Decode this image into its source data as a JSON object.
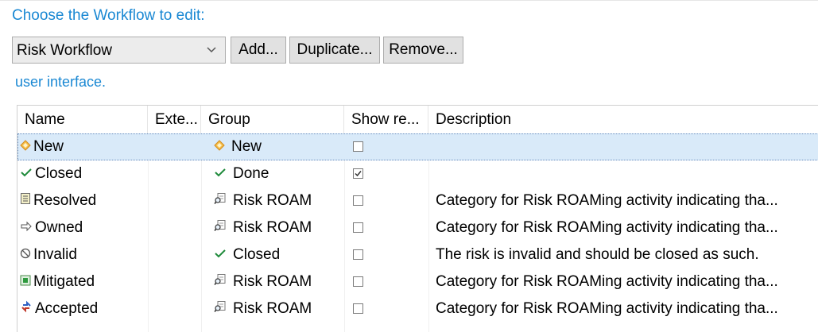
{
  "heading": "Choose the Workflow to edit:",
  "workflow_select": {
    "value": "Risk Workflow"
  },
  "buttons": {
    "add": "Add...",
    "duplicate": "Duplicate...",
    "remove": "Remove..."
  },
  "link": "user interface.",
  "table": {
    "columns": [
      "Name",
      "Exte...",
      "Group",
      "Show re...",
      "Description"
    ],
    "rows": [
      {
        "name": "New",
        "name_icon": "diamond-icon",
        "ext": "",
        "group": "New",
        "group_icon": "diamond-icon",
        "show": false,
        "description": ""
      },
      {
        "name": "Closed",
        "name_icon": "check-icon",
        "ext": "",
        "group": "Done",
        "group_icon": "check-icon",
        "show": true,
        "description": ""
      },
      {
        "name": "Resolved",
        "name_icon": "document-icon",
        "ext": "",
        "group": "Risk ROAM",
        "group_icon": "magnifier-icon",
        "show": false,
        "description": "Category for Risk ROAMing activity indicating tha..."
      },
      {
        "name": "Owned",
        "name_icon": "arrow-right-icon",
        "ext": "",
        "group": "Risk ROAM",
        "group_icon": "magnifier-icon",
        "show": false,
        "description": "Category for Risk ROAMing activity indicating tha..."
      },
      {
        "name": "Invalid",
        "name_icon": "no-entry-icon",
        "ext": "",
        "group": "Closed",
        "group_icon": "check-icon",
        "show": false,
        "description": "The risk is invalid and should be closed as such."
      },
      {
        "name": "Mitigated",
        "name_icon": "green-square-icon",
        "ext": "",
        "group": "Risk ROAM",
        "group_icon": "magnifier-icon",
        "show": false,
        "description": "Category for Risk ROAMing activity indicating tha..."
      },
      {
        "name": "Accepted",
        "name_icon": "accept-arrows-icon",
        "ext": "",
        "group": "Risk ROAM",
        "group_icon": "magnifier-icon",
        "show": false,
        "description": "Category for Risk ROAMing activity indicating tha..."
      }
    ]
  },
  "colors": {
    "accent": "#1a88d3",
    "selection": "#d9eaf9",
    "check_green": "#1e8a3a",
    "diamond_orange": "#e8a13a"
  }
}
